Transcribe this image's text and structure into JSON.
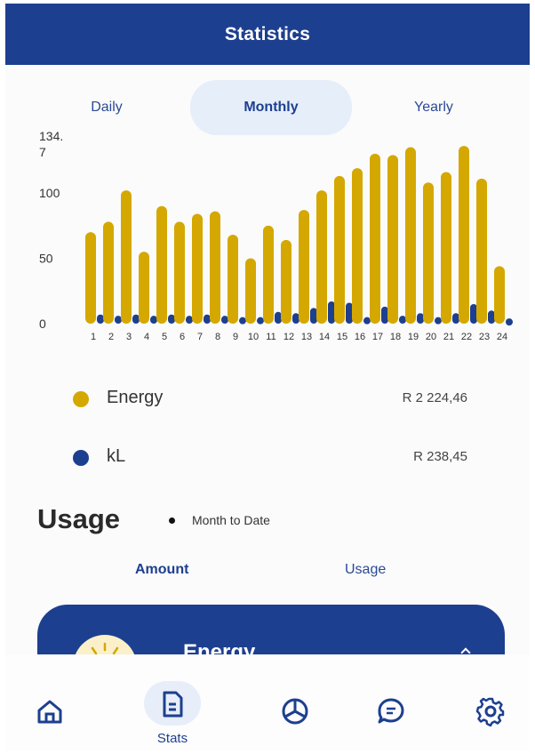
{
  "header": {
    "title": "Statistics"
  },
  "tabs": [
    {
      "label": "Daily",
      "active": false
    },
    {
      "label": "Monthly",
      "active": true
    },
    {
      "label": "Yearly",
      "active": false
    }
  ],
  "colors": {
    "primary": "#1d3f8f",
    "energy": "#d4a800",
    "kl": "#1d3f8f",
    "tab_active_bg": "#e6eef9"
  },
  "chart_data": {
    "type": "bar",
    "categories": [
      "1",
      "2",
      "3",
      "4",
      "5",
      "6",
      "7",
      "8",
      "9",
      "10",
      "11",
      "12",
      "13",
      "14",
      "15",
      "16",
      "17",
      "18",
      "19",
      "20",
      "21",
      "22",
      "23",
      "24"
    ],
    "series": [
      {
        "name": "Energy",
        "values": [
          70,
          78,
          102,
          55,
          90,
          78,
          84,
          86,
          68,
          50,
          75,
          64,
          87,
          102,
          113,
          119,
          130,
          129,
          135,
          108,
          116,
          136,
          111,
          44
        ]
      },
      {
        "name": "kL",
        "values": [
          7,
          6,
          7,
          6,
          7,
          6,
          7,
          6,
          5,
          5,
          9,
          8,
          12,
          17,
          16,
          5,
          13,
          6,
          8,
          5,
          8,
          15,
          10,
          4
        ]
      }
    ],
    "yticks": [
      "0",
      "50",
      "100",
      "134.\n7"
    ],
    "ylim": [
      0,
      134.7
    ],
    "grid": false
  },
  "legend": [
    {
      "label": "Energy",
      "value": "R 2 224,46",
      "color": "#d4a800"
    },
    {
      "label": "kL",
      "value": "R 238,45",
      "color": "#1d3f8f"
    }
  ],
  "usage": {
    "title": "Usage",
    "subtitle": "Month to Date"
  },
  "subtabs": [
    {
      "label": "Amount",
      "active": true
    },
    {
      "label": "Usage",
      "active": false
    }
  ],
  "card": {
    "title": "Energy",
    "icon": "sun-icon"
  },
  "nav": [
    {
      "icon": "home-icon",
      "label": ""
    },
    {
      "icon": "document-icon",
      "label": "Stats",
      "active": true
    },
    {
      "icon": "pie-chart-icon",
      "label": ""
    },
    {
      "icon": "chat-icon",
      "label": ""
    },
    {
      "icon": "gear-icon",
      "label": ""
    }
  ]
}
